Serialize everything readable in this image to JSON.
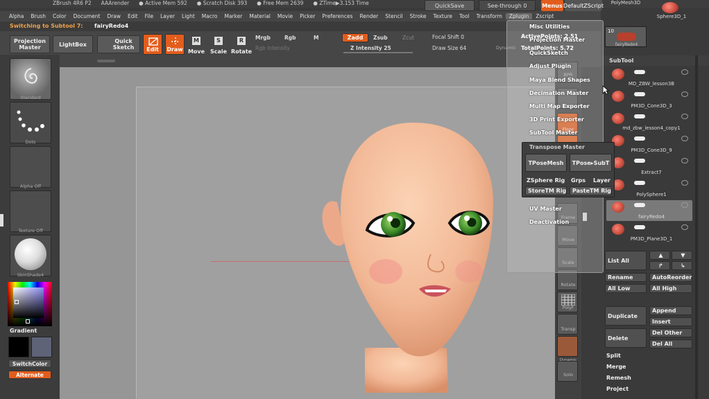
{
  "titlebar": {
    "app": "ZBrush 4R6 P2",
    "render": "AAArender",
    "active_mem": "● Active Mem 592",
    "scratch": "● Scratch Disk 393",
    "free_mem": "● Free Mem 2639",
    "ztime": "● ZTime▶3.153 Time",
    "quicksave": "QuickSave",
    "seethrough": "See-through  0",
    "menus": "Menus",
    "default_script": "DefaultZScript"
  },
  "menus": [
    "Alpha",
    "Brush",
    "Color",
    "Document",
    "Draw",
    "Edit",
    "File",
    "Layer",
    "Light",
    "Macro",
    "Marker",
    "Material",
    "Movie",
    "Picker",
    "Preferences",
    "Render",
    "Stencil",
    "Stroke",
    "Texture",
    "Tool",
    "Transform",
    "Zplugin",
    "Zscript"
  ],
  "menu_active": "Zplugin",
  "notice": {
    "prefix": "Switching to Subtool 7:",
    "name": "fairyRedo4"
  },
  "toolbar": {
    "projection_master": "Projection Master",
    "lightbox": "LightBox",
    "quick_sketch": "Quick Sketch",
    "edit": "Edit",
    "draw": "Draw",
    "move": "Move",
    "scale": "Scale",
    "rotate": "Rotate",
    "mrgb": "Mrgb",
    "rgb": "Rgb",
    "m": "M",
    "rgb_intensity": "Rgb Intensity",
    "zadd": "Zadd",
    "zsub": "Zsub",
    "zcut": "Zcut",
    "z_intensity": "Z Intensity 25",
    "focal_shift": "Focal Shift 0",
    "draw_size": "Draw Size 64",
    "dynamic": "Dynamic",
    "active_points": "ActivePoints: 2.51",
    "total_points": "TotalPoints: 5.72"
  },
  "left_shelf": {
    "standard": "Standard",
    "dots": "Dots",
    "alpha_off": "Alpha Off",
    "texture_off": "Texture Off",
    "skinshade": "SkinShade4",
    "gradient": "Gradient",
    "switch_color": "SwitchColor",
    "alternate": "Alternate"
  },
  "right_shelf": {
    "bpr": "BPR",
    "persp": "Persp",
    "floor": "Floor",
    "local": "Local",
    "frame": "Frame",
    "move": "Move",
    "scale": "Scale",
    "rotate": "Rotate",
    "polyf": "PolyF",
    "transp": "Transp",
    "dynamic": "Dynamic",
    "solo": "Solo"
  },
  "top_tools": {
    "polymesh": "PolyMesh3D",
    "sphere": "Sphere3D_1",
    "count": "10",
    "fairy": "fairyRedo4"
  },
  "subtool": {
    "title": "SubTool",
    "items": [
      "MD_ZBW_lesson3B",
      "PM3D_Cone3D_3",
      "md_zbw_lesson4_copy1",
      "PM3D_Cone3D_9",
      "Extract7",
      "PolySphere1",
      "fairyRedo4",
      "PM3D_Plane3D_1"
    ],
    "list_all": "List All",
    "rename": "Rename",
    "auto_reorder": "AutoReorder",
    "all_low": "All Low",
    "all_high": "All High",
    "duplicate": "Duplicate",
    "append": "Append",
    "insert": "Insert",
    "delete": "Delete",
    "del_other": "Del Other",
    "del_all": "Del All",
    "split": "Split",
    "merge": "Merge",
    "remesh": "Remesh",
    "project": "Project"
  },
  "zplugin_menu": {
    "items": [
      "Misc Utilities",
      "Projection Master",
      "QuickSketch",
      "Adjust Plugin",
      "Maya Blend Shapes",
      "Decimation Master",
      "Multi Map Exporter",
      "3D Print Exporter",
      "SubTool Master"
    ],
    "transpose_master": "Transpose Master",
    "tposemesh": "TPoseMesh",
    "tpose_subt": "TPose▸SubT",
    "zsphere_rig": "ZSphere Rig",
    "grps": "Grps",
    "layer": "Layer",
    "storetm_rig": "StoreTM Rig",
    "pastetm_rig": "PasteTM Rig",
    "uv_master": "UV Master",
    "deactivation": "Deactivation"
  },
  "colors": {
    "accent": "#e25d1c",
    "canvas": "#969696",
    "panel": "#3a3a3a",
    "skin": "#f2b896"
  }
}
